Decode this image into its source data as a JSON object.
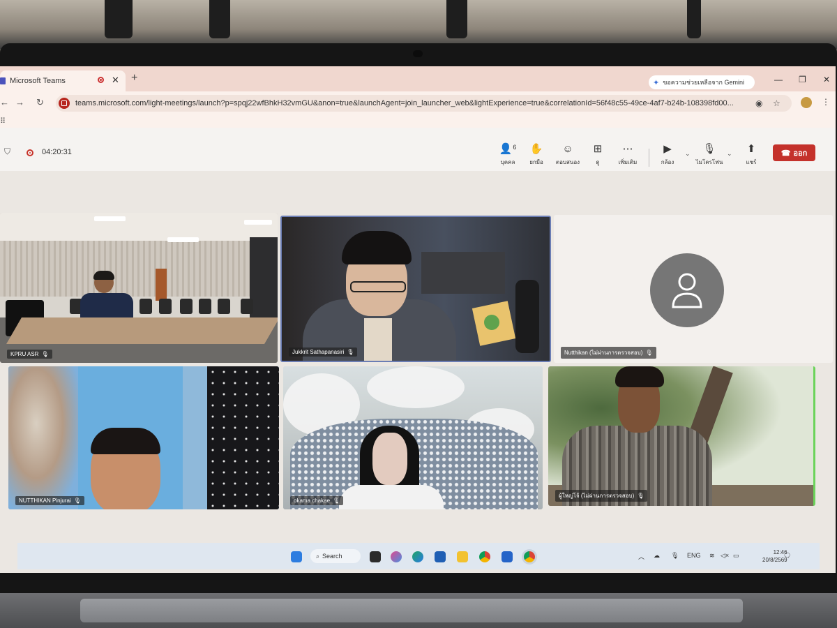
{
  "browser": {
    "tab_title": "Microsoft Teams",
    "tab_close": "✕",
    "new_tab": "+",
    "gemini_label": "ขอความช่วยเหลือจาก Gemini",
    "url": "teams.microsoft.com/light-meetings/launch?p=spqj22wfBhkH32vmGU&anon=true&launchAgent=join_launcher_web&lightExperience=true&correlationId=56f48c55-49ce-4af7-b24b-108398fd00..."
  },
  "meeting": {
    "timer": "04:20:31",
    "controls": {
      "people_label": "บุคคล",
      "people_count": "6",
      "raise_label": "ยกมือ",
      "react_label": "ตอบสนอง",
      "view_label": "ดู",
      "more_label": "เพิ่มเติม",
      "camera_label": "กล้อง",
      "mic_label": "ไมโครโฟน",
      "share_label": "แชร์",
      "leave_label": "ออก"
    }
  },
  "participants": [
    {
      "name": "KPRU ASR"
    },
    {
      "name": "Jukkrit Sathapanasiri"
    },
    {
      "name": "Nutthikan (ไม่ผ่านการตรวจสอบ)"
    },
    {
      "name": "NUTTHIKAN Pinjurai"
    },
    {
      "name": "okama chakae"
    },
    {
      "name": "ผู้ใหญ่โจ้ (ไม่ผ่านการตรวจสอบ)"
    }
  ],
  "taskbar": {
    "search_label": "Search",
    "language": "ENG",
    "time": "12:46",
    "date": "20/8/2569"
  },
  "colors": {
    "leave_button": "#c4312b",
    "tab_bar": "#f0d7cf",
    "avatar": "#767676"
  }
}
